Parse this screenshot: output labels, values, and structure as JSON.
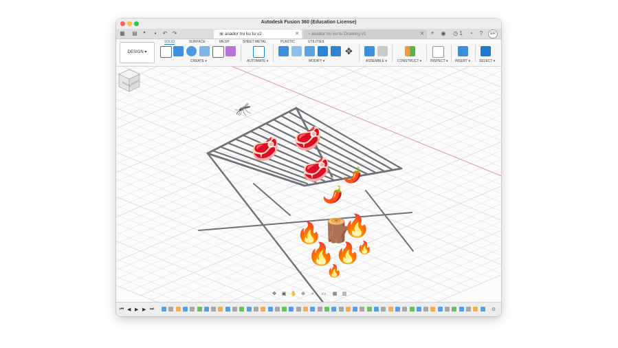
{
  "window": {
    "title": "Autodesk Fusion 360 (Education License)",
    "traffic_lights": [
      "#ff5f57",
      "#febc2e",
      "#28c840"
    ]
  },
  "tabs": [
    {
      "label": "asador tru ku tu v2",
      "active": true
    },
    {
      "label": "asador tru ku tu Drawing v1",
      "active": false
    }
  ],
  "tabbar_right": {
    "jobs_count": "1",
    "user_initials": "ER"
  },
  "ribbon": {
    "design_label": "DESIGN ▾",
    "tabs": [
      "SOLID",
      "SURFACE",
      "MESH",
      "SHEET METAL",
      "PLASTIC",
      "UTILITIES"
    ],
    "groups": [
      "CREATE ▾",
      "AUTOMATE ▾",
      "MODIFY ▾",
      "ASSEMBLE ▾",
      "CONSTRUCT ▾",
      "INSPECT ▾",
      "INSERT ▾",
      "SELECT ▾"
    ]
  },
  "view_cube": {
    "faces": [
      "FRONT",
      "RIGHT"
    ]
  },
  "model_decorations": {
    "steaks": [
      "🥩",
      "🥩",
      "🥩"
    ],
    "peppers": [
      "🌶️",
      "🌶️"
    ],
    "fire": [
      "🔥",
      "🔥",
      "🔥",
      "🔥",
      "🔥",
      "🔥"
    ],
    "log": "🪵",
    "fly": "🦟"
  },
  "colors": {
    "accent": "#1b7bd1",
    "grid_line": "#d6d9de",
    "x_axis": "#e08a8a",
    "grill_bar": "#6e7276"
  }
}
